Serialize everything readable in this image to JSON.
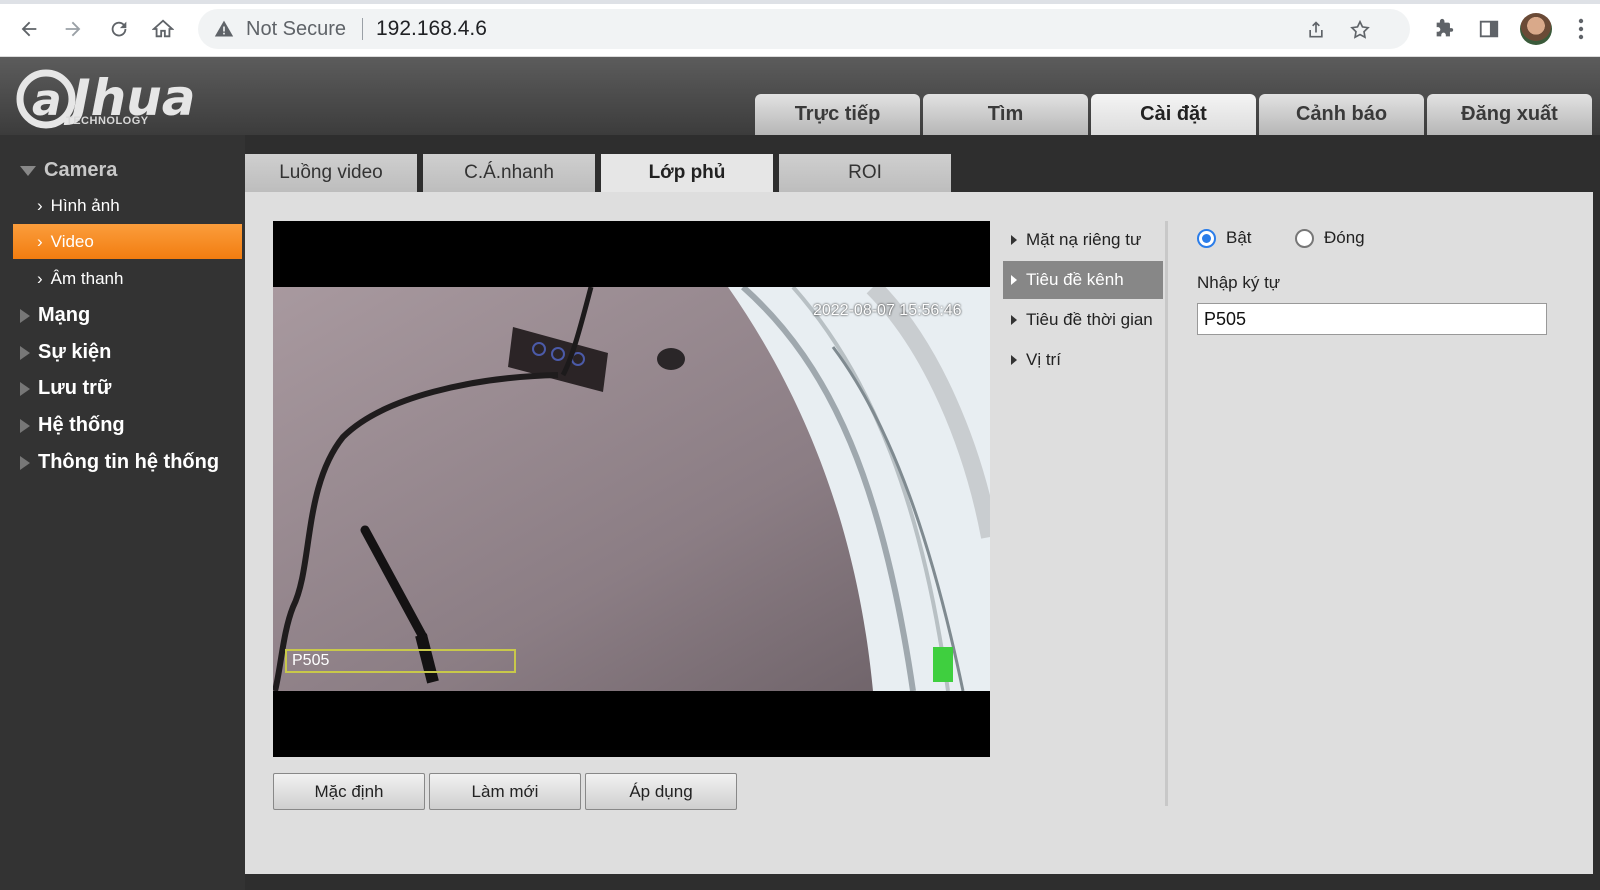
{
  "browser": {
    "security_label": "Not Secure",
    "url": "192.168.4.6"
  },
  "brand": {
    "logo_text": "a hua",
    "logo_sub": "TECHNOLOGY"
  },
  "main_tabs": [
    {
      "label": "Trực tiếp",
      "active": false
    },
    {
      "label": "Tìm",
      "active": false
    },
    {
      "label": "Cài đặt",
      "active": true
    },
    {
      "label": "Cảnh báo",
      "active": false
    },
    {
      "label": "Đăng xuất",
      "active": false
    }
  ],
  "sidebar": {
    "camera": "Camera",
    "camera_items": [
      "Hình ảnh",
      "Video",
      "Âm thanh"
    ],
    "active_item": "Video",
    "sections": [
      "Mạng",
      "Sự kiện",
      "Lưu trữ",
      "Hệ thống",
      "Thông tin hệ thống"
    ]
  },
  "sub_tabs": [
    {
      "label": "Luồng video",
      "active": false
    },
    {
      "label": "C.Á.nhanh",
      "active": false
    },
    {
      "label": "Lớp phủ",
      "active": true
    },
    {
      "label": "ROI",
      "active": false
    }
  ],
  "video": {
    "timestamp": "2022-08-07 15:56:46",
    "channel_title": "P505"
  },
  "buttons": {
    "default": "Mặc định",
    "refresh": "Làm mới",
    "apply": "Áp dụng"
  },
  "osd_menu": [
    {
      "label": "Mặt nạ riêng tư",
      "active": false
    },
    {
      "label": "Tiêu đề kênh",
      "active": true
    },
    {
      "label": "Tiêu đề thời gian",
      "active": false
    },
    {
      "label": "Vị trí",
      "active": false
    }
  ],
  "settings": {
    "on_label": "Bật",
    "off_label": "Đóng",
    "selected": "on",
    "input_label": "Nhập ký tự",
    "input_value": "P505"
  },
  "colors": {
    "accent_orange": "#f27d10",
    "radio_blue": "#2b7de9"
  }
}
